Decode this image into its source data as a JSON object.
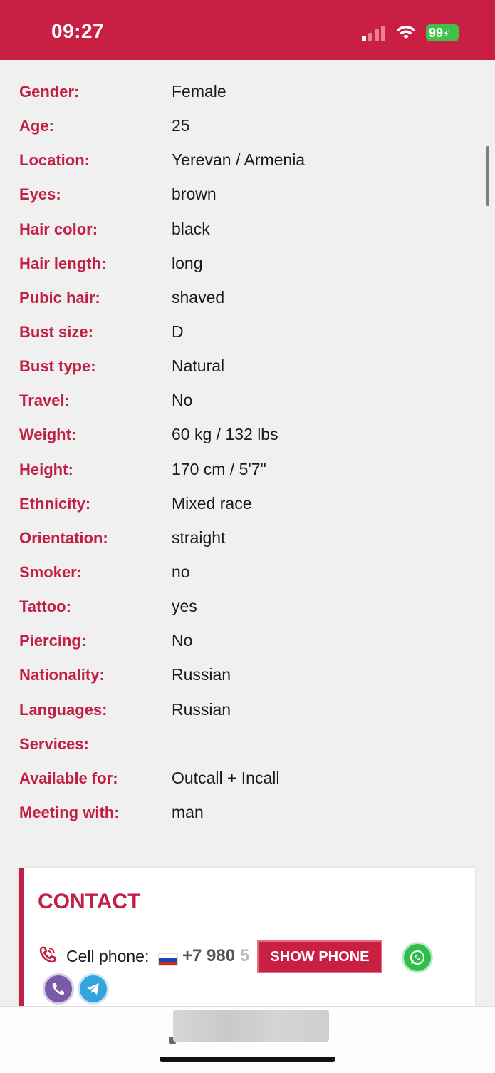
{
  "status_bar": {
    "time": "09:27",
    "battery": "99",
    "signal_bars_active": 1,
    "signal_bars_total": 4
  },
  "details": [
    {
      "label": "Gender:",
      "value": "Female"
    },
    {
      "label": "Age:",
      "value": "25"
    },
    {
      "label": "Location:",
      "value": "Yerevan / Armenia"
    },
    {
      "label": "Eyes:",
      "value": "brown"
    },
    {
      "label": "Hair color:",
      "value": "black"
    },
    {
      "label": "Hair length:",
      "value": "long"
    },
    {
      "label": "Pubic hair:",
      "value": "shaved"
    },
    {
      "label": "Bust size:",
      "value": "D"
    },
    {
      "label": "Bust type:",
      "value": "Natural"
    },
    {
      "label": "Travel:",
      "value": "No"
    },
    {
      "label": "Weight:",
      "value": "60 kg / 132 lbs"
    },
    {
      "label": "Height:",
      "value": "170 cm / 5'7\""
    },
    {
      "label": "Ethnicity:",
      "value": "Mixed race"
    },
    {
      "label": "Orientation:",
      "value": "straight"
    },
    {
      "label": "Smoker:",
      "value": "no"
    },
    {
      "label": "Tattoo:",
      "value": "yes"
    },
    {
      "label": "Piercing:",
      "value": "No"
    },
    {
      "label": "Nationality:",
      "value": "Russian"
    },
    {
      "label": "Languages:",
      "value": "Russian"
    },
    {
      "label": "Services:",
      "value": ""
    },
    {
      "label": "Available for:",
      "value": "Outcall + Incall"
    },
    {
      "label": "Meeting with:",
      "value": "man"
    }
  ],
  "contact": {
    "title": "CONTACT",
    "cell_label": "Cell phone:",
    "phone_visible": "+7 980",
    "phone_faded": " 5",
    "show_phone_label": "SHOW PHONE",
    "icons": [
      "phone-icon",
      "whatsapp-icon",
      "viber-icon",
      "telegram-icon"
    ]
  },
  "colors": {
    "brand_red": "#c81f43",
    "label_red": "#c21f45",
    "whatsapp": "#2ebf4a",
    "viber": "#7a59a6",
    "telegram": "#35a4dd",
    "battery": "#3fc14c"
  }
}
